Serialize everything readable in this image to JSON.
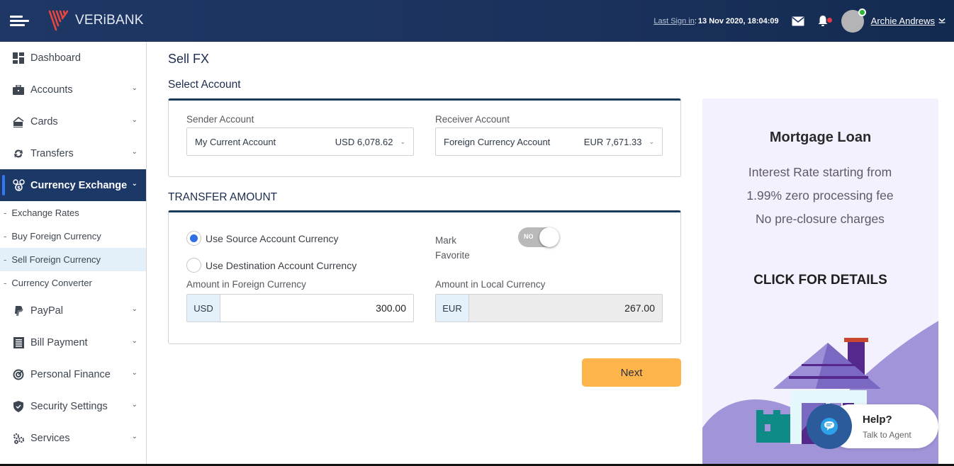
{
  "header": {
    "brand": "VERiBANK",
    "last_sign_in_label": "Last Sign in",
    "last_sign_in_sep": ":",
    "last_sign_in_value": "13 Nov 2020, 18:04:09",
    "user_name": "Archie Andrews",
    "icons": [
      "menu-icon",
      "mail-icon",
      "bell-icon",
      "avatar",
      "chevron-down-icon"
    ]
  },
  "sidebar": {
    "items": [
      {
        "label": "Dashboard",
        "icon": "dashboard-icon",
        "has_chevron": false
      },
      {
        "label": "Accounts",
        "icon": "briefcase-icon",
        "has_chevron": true
      },
      {
        "label": "Cards",
        "icon": "card-icon",
        "has_chevron": true
      },
      {
        "label": "Transfers",
        "icon": "transfer-icon",
        "has_chevron": true
      },
      {
        "label": "Currency Exchange",
        "icon": "currency-exchange-icon",
        "has_chevron": true,
        "active": true
      },
      {
        "label": "PayPal",
        "icon": "paypal-icon",
        "has_chevron": true
      },
      {
        "label": "Bill Payment",
        "icon": "bill-icon",
        "has_chevron": true
      },
      {
        "label": "Personal Finance",
        "icon": "target-icon",
        "has_chevron": true
      },
      {
        "label": "Security Settings",
        "icon": "shield-icon",
        "has_chevron": true
      },
      {
        "label": "Services",
        "icon": "gears-icon",
        "has_chevron": true
      }
    ],
    "sub_items": [
      {
        "label": "Exchange Rates"
      },
      {
        "label": "Buy Foreign Currency"
      },
      {
        "label": "Sell Foreign Currency",
        "active": true
      },
      {
        "label": "Currency Converter"
      }
    ],
    "chevron": "⌄",
    "dash": "-"
  },
  "main": {
    "page_title": "Sell FX",
    "select_account": {
      "title": "Select Account",
      "sender_label": "Sender Account",
      "sender_name": "My Current Account",
      "sender_balance": "USD 6,078.62",
      "receiver_label": "Receiver Account",
      "receiver_name": "Foreign Currency Account",
      "receiver_balance": "EUR 7,671.33"
    },
    "transfer_amount": {
      "title": "TRANSFER AMOUNT",
      "radio_source": "Use Source Account Currency",
      "radio_destination": "Use Destination Account Currency",
      "selected_radio": "source",
      "mark_favorite_label_1": "Mark",
      "mark_favorite_label_2": "Favorite",
      "toggle_label": "NO",
      "toggle_on": false,
      "foreign_label": "Amount in Foreign Currency",
      "foreign_currency": "USD",
      "foreign_value": "300.00",
      "local_label": "Amount in Local Currency",
      "local_currency": "EUR",
      "local_value": "267.00"
    },
    "next_label": "Next"
  },
  "promo": {
    "title": "Mortgage Loan",
    "body": "Interest Rate starting from 1.99% zero processing fee No pre-closure charges",
    "cta": "CLICK FOR DETAILS"
  },
  "help": {
    "title": "Help?",
    "subtitle": "Talk to Agent"
  },
  "colors": {
    "header_bg": "#1e3764",
    "active_nav_bg": "#1c3867",
    "accent_blue": "#3276f0",
    "next_button": "#fdb44b",
    "promo_bg": "#f3f1fd",
    "online_dot": "#27b832",
    "notification_dot": "#e63946"
  }
}
